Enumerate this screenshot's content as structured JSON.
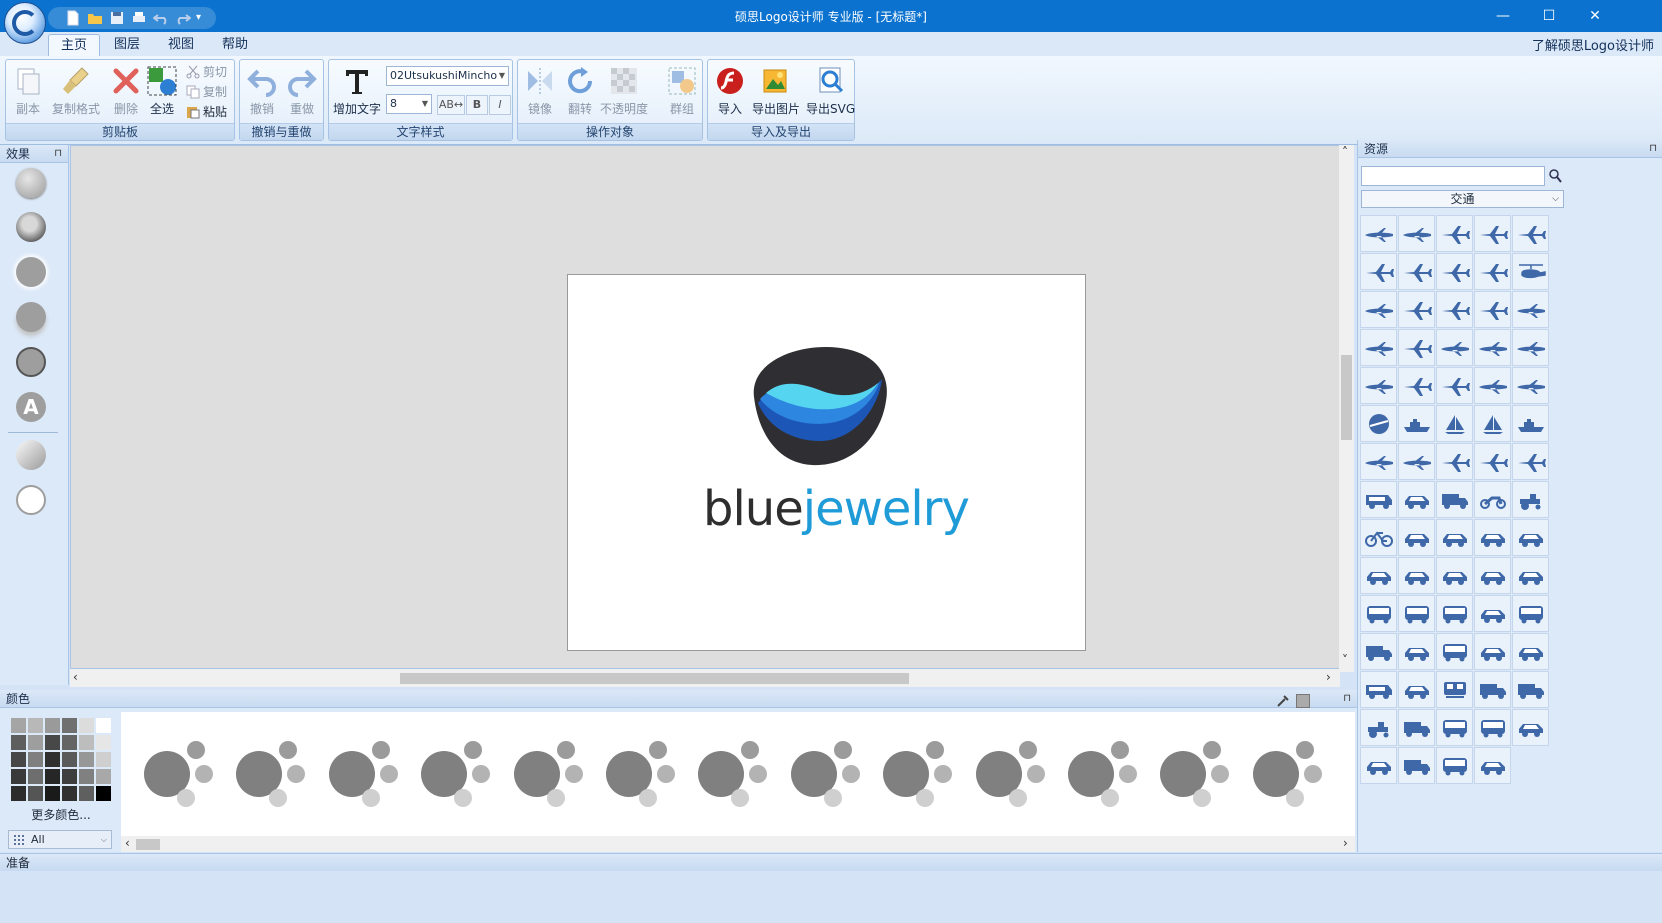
{
  "window": {
    "title": "硕思Logo设计师 专业版 - [无标题*]",
    "controls": {
      "minimize": "—",
      "maximize": "☐",
      "close": "✕"
    }
  },
  "quick_access": {
    "items": [
      "new-icon",
      "open-icon",
      "save-icon",
      "print-icon",
      "undo-icon",
      "redo-icon"
    ],
    "more": "▾"
  },
  "tabs": [
    {
      "label": "主页",
      "active": true
    },
    {
      "label": "图层",
      "active": false
    },
    {
      "label": "视图",
      "active": false
    },
    {
      "label": "帮助",
      "active": false
    }
  ],
  "about_link": "了解硕思Logo设计师",
  "ribbon": {
    "clipboard": {
      "label": "剪贴板",
      "duplicate": "副本",
      "format_painter": "复制格式",
      "delete": "删除",
      "select_all": "全选",
      "cut": "剪切",
      "copy": "复制",
      "paste": "粘贴"
    },
    "undo_redo": {
      "label": "撤销与重做",
      "undo": "撤销",
      "redo": "重做"
    },
    "text_style": {
      "label": "文字样式",
      "add_text": "增加文字",
      "font_name": "02UtsukushiMincho",
      "font_size": "8",
      "bold": "B",
      "italic": "I"
    },
    "operate": {
      "label": "操作对象",
      "mirror": "镜像",
      "rotate": "翻转",
      "opacity": "不透明度",
      "group": "群组"
    },
    "import_export": {
      "label": "导入及导出",
      "import": "导入",
      "export_image": "导出图片",
      "export_svg": "导出SVG"
    }
  },
  "effects_panel": {
    "title": "效果",
    "pin": "ᵖ"
  },
  "canvas": {
    "logo_word_1": "blue",
    "logo_word_2": "jewelry",
    "colors": {
      "dark": "#2e2e2e",
      "blue": "#1f9bd8"
    }
  },
  "resources_panel": {
    "title": "资源",
    "search_placeholder": "",
    "category": "交通"
  },
  "colors_panel": {
    "title": "颜色",
    "more_colors": "更多颜色...",
    "palette": "All"
  },
  "status": {
    "text": "准备"
  }
}
